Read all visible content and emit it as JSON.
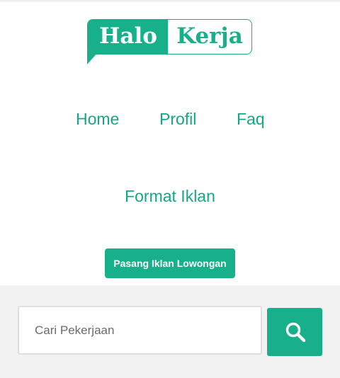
{
  "brand": {
    "left_word": "Halo",
    "right_word": "Kerja",
    "color": "#17b08a"
  },
  "nav": {
    "home": "Home",
    "profil": "Profil",
    "faq": "Faq",
    "format_iklan": "Format Iklan"
  },
  "cta": {
    "post_job_label": "Pasang Iklan Lowongan"
  },
  "search": {
    "placeholder": "Cari Pekerjaan",
    "value": "",
    "button_icon": "search-icon"
  }
}
